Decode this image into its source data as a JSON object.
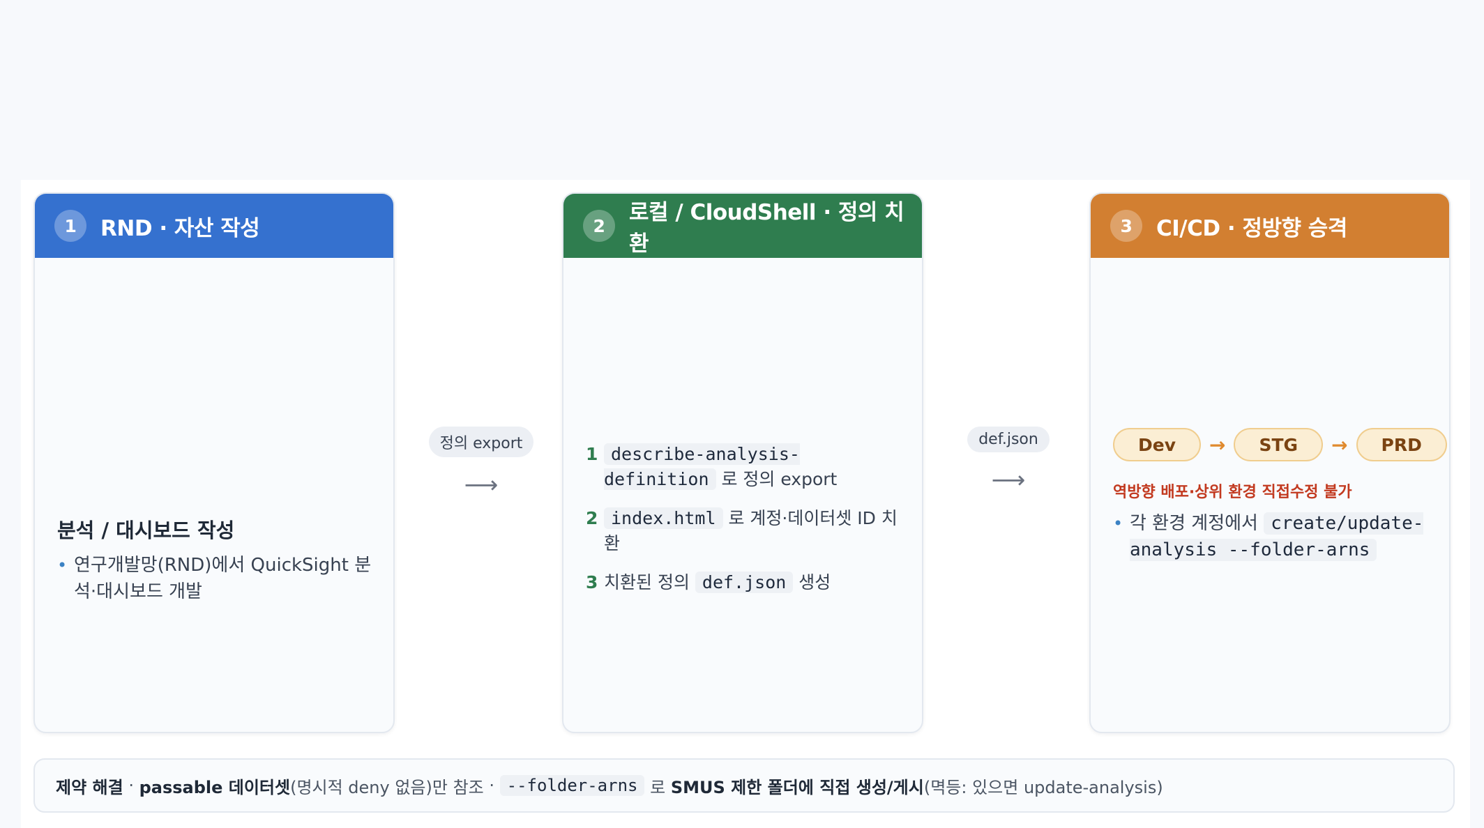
{
  "colors": {
    "card1": "#3571cf",
    "card2": "#2f7d4f",
    "card3": "#d27f31"
  },
  "card1": {
    "number": "1",
    "title": "RND · 자산 작성",
    "section_title": "분석 / 대시보드 작성",
    "bullet": "연구개발망(RND)에서 QuickSight 분석·대시보드 개발"
  },
  "connector1": {
    "label": "정의 export",
    "arrow": "⟶"
  },
  "card2": {
    "number": "2",
    "title": "로컬 / CloudShell · 정의 치환",
    "steps": [
      {
        "n": "1",
        "code": "describe-analysis-definition",
        "text": " 로 정의 export"
      },
      {
        "n": "2",
        "code": "index.html",
        "text": " 로 계정·데이터셋 ID 치환"
      },
      {
        "n": "3",
        "pre": "치환된 정의 ",
        "code": "def.json",
        "text": " 생성"
      }
    ]
  },
  "connector2": {
    "label": "def.json",
    "arrow": "⟶"
  },
  "card3": {
    "number": "3",
    "title": "CI/CD · 정방향 승격",
    "envs": [
      "Dev",
      "STG",
      "PRD"
    ],
    "env_arrow": "→",
    "warning": "역방향 배포·상위 환경 직접수정 불가",
    "bullet_text": "각 환경 계정에서 ",
    "bullet_code": "create/update-analysis --folder-arns"
  },
  "footer": {
    "lead": "제약 해결",
    "sep1": " · ",
    "bold1": "passable 데이터셋",
    "paren1": "(명시적 deny 없음)만 참조",
    "sep2": " · ",
    "code": "--folder-arns",
    "mid": " 로 ",
    "bold2": "SMUS 제한 폴더에 직접 생성/게시",
    "paren2": "(멱등: 있으면 update-analysis)"
  }
}
